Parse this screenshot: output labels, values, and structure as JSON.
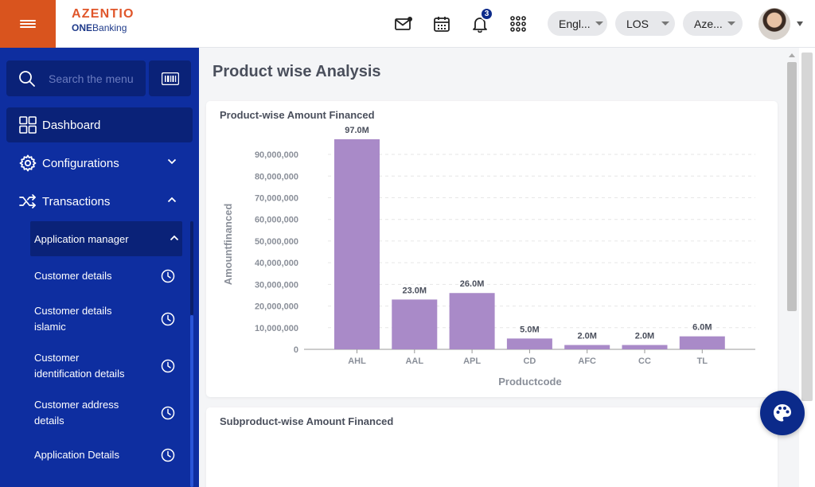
{
  "brand": {
    "name": "AZENTIO",
    "product_bold": "ONE",
    "product_rest": "Banking"
  },
  "header": {
    "notification_count": "3",
    "language": "Engl...",
    "module": "LOS",
    "entity": "Aze..."
  },
  "icons": {
    "menu": "hamburger-icon",
    "mail": "mail-icon",
    "calendar": "calendar-icon",
    "bell": "bell-icon",
    "apps": "apps-grid-icon",
    "search": "search-icon",
    "barcode": "barcode-icon",
    "dashboard": "dashboard-grid-icon",
    "configurations": "gear-icon",
    "transactions": "shuffle-icon",
    "clock": "clock-icon",
    "palette": "palette-icon"
  },
  "sidebar": {
    "search_placeholder": "Search the menu",
    "items": [
      {
        "label": "Dashboard"
      },
      {
        "label": "Configurations"
      },
      {
        "label": "Transactions"
      }
    ],
    "submenu_header": "Application manager",
    "submenu": [
      {
        "label": "Customer details"
      },
      {
        "label": "Customer details islamic"
      },
      {
        "label": "Customer identification details"
      },
      {
        "label": "Customer address details"
      },
      {
        "label": "Application Details"
      }
    ]
  },
  "main": {
    "page_title": "Product wise Analysis",
    "card1_title": "Product-wise Amount Financed",
    "card2_title": "Subproduct-wise Amount Financed"
  },
  "colors": {
    "bar": "#a98ac8",
    "sidebar": "#0e2ea0",
    "accent": "#d9541e"
  },
  "chart_data": {
    "type": "bar",
    "title": "Product-wise Amount Financed",
    "xlabel": "Productcode",
    "ylabel": "Amountfinanced",
    "categories": [
      "AHL",
      "AAL",
      "APL",
      "CD",
      "AFC",
      "CC",
      "TL"
    ],
    "values": [
      97000000,
      23000000,
      26000000,
      5000000,
      2000000,
      2000000,
      6000000
    ],
    "data_labels": [
      "97.0M",
      "23.0M",
      "26.0M",
      "5.0M",
      "2.0M",
      "2.0M",
      "6.0M"
    ],
    "yticks": [
      0,
      10000000,
      20000000,
      30000000,
      40000000,
      50000000,
      60000000,
      70000000,
      80000000,
      90000000
    ],
    "ytick_labels": [
      "0",
      "10,000,000",
      "20,000,000",
      "30,000,000",
      "40,000,000",
      "50,000,000",
      "60,000,000",
      "70,000,000",
      "80,000,000",
      "90,000,000"
    ],
    "ylim": [
      0,
      97000000
    ],
    "grid": true,
    "legend": "none"
  }
}
